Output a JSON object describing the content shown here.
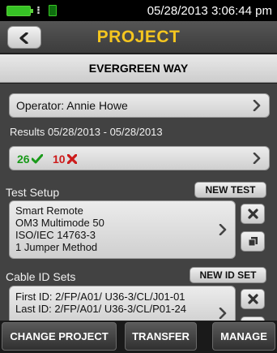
{
  "status": {
    "datetime": "05/28/2013 3:06:44 pm"
  },
  "header": {
    "title": "PROJECT",
    "back_icon": "chevron-left-icon"
  },
  "project": {
    "name": "EVERGREEN WAY"
  },
  "operator": {
    "label": "Operator: Annie Howe"
  },
  "results": {
    "range_label": "Results 05/28/2013 - 05/28/2013",
    "pass_count": "26",
    "fail_count": "10",
    "pass_color": "#1a9a1a",
    "fail_color": "#cc1b1b"
  },
  "test_setup": {
    "label": "Test Setup",
    "new_button": "NEW TEST",
    "lines": [
      "Smart Remote",
      "OM3 Multimode 50",
      "ISO/IEC 14763-3",
      "1 Jumper Method"
    ]
  },
  "cable_id_sets": {
    "label": "Cable ID Sets",
    "new_button": "NEW ID SET",
    "lines": [
      "First ID: 2/FP/A01/ U36-3/CL/J01-01",
      "Last ID: 2/FP/A01/ U36-3/CL/P01-24"
    ]
  },
  "bottom": {
    "change_project": "CHANGE PROJECT",
    "transfer": "TRANSFER",
    "manage": "MANAGE"
  },
  "colors": {
    "title": "#f5c61f",
    "battery": "#36c225"
  }
}
